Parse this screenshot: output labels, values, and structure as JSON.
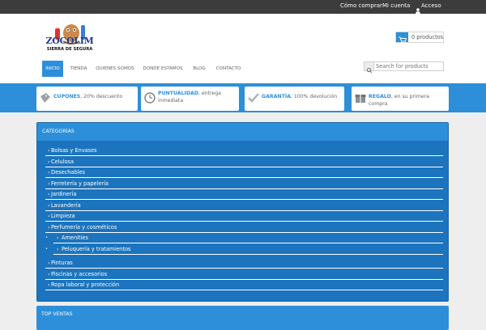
{
  "topbar": {
    "links": [
      "Cómo comprar",
      "Mi cuenta",
      "Acceso"
    ]
  },
  "logo": {
    "name": "ZOCOLIM",
    "subtitle": "SIERRA DE SEGURA"
  },
  "cart": {
    "label": "0 productos",
    "icon": "cart-icon"
  },
  "nav": {
    "items": [
      "INICIO",
      "TIENDA",
      "QUIENES SOMOS",
      "DONDE ESTAMOS",
      "BLOG",
      "CONTACTO"
    ],
    "active": "INICIO"
  },
  "search": {
    "placeholder": "Search for products",
    "icon": "search-icon"
  },
  "promos": [
    {
      "title": "CUPONES",
      "text": ", 20% descuento",
      "icon": "coupon-icon"
    },
    {
      "title": "PUNTUALIDAD",
      "text": ", entrega inmediata",
      "icon": "clock-icon"
    },
    {
      "title": "GARANTÍA",
      "text": ", 100% devolución",
      "icon": "checkmark-icon"
    },
    {
      "title": "REGALO",
      "text": ", en su primera compra",
      "icon": "gift-icon"
    }
  ],
  "categories": {
    "heading": "CATEGORÍAS",
    "items": [
      "Bolsas y Envases",
      "Celulosa",
      "Desechables",
      "Ferretería y papelería",
      "Jardinería",
      "Lavandería",
      "Limpieza",
      "Perfumería y cosméticos",
      "Pinturas",
      "Piscinas y accesorios",
      "Ropa laboral y protección"
    ],
    "subitems": [
      "Amenities",
      "Peluquería y tratamientos"
    ]
  },
  "top_sales": {
    "heading": "TOP VENTAS"
  },
  "colors": {
    "accent": "#2d8fd9",
    "panel": "#1b74bd",
    "topbar": "#3c3c3c"
  }
}
